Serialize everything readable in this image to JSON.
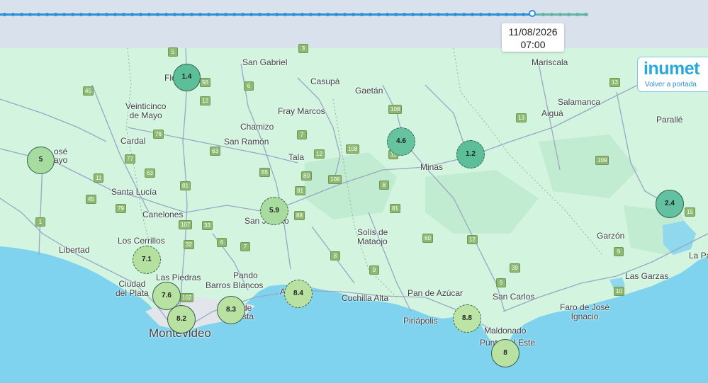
{
  "timeline": {
    "selected_date": "11/08/2026",
    "selected_time": "07:00"
  },
  "logo": {
    "brand": "inumet",
    "back_label": "Volver a portada"
  },
  "places": {
    "mariscala": "Mariscala",
    "san_gabriel": "San Gabriel",
    "casupa": "Casupá",
    "gaetan": "Gaetán",
    "salamanca": "Salamanca",
    "veinticinco_de_mayo": "Veinticinco\nde Mayo",
    "fray_marcos": "Fray Marcos",
    "aigua": "Aiguá",
    "parallel": "Parallé",
    "chamizo": "Chamizo",
    "cardal": "Cardal",
    "san_ramon": "San Ramón",
    "jose_fragment": "osé\nayo",
    "tala": "Tala",
    "minas": "Minas",
    "santa_lucia": "Santa Lucía",
    "canelones": "Canelones",
    "san_jacinto": "San Jacinto",
    "solis_de_mataojo": "Solís de\nMataojo",
    "garzon": "Garzón",
    "los_cerrillos": "Los Cerrillos",
    "libertad": "Libertad",
    "la_pa": "La Pa",
    "pando": "Pando",
    "las_piedras": "Las Piedras",
    "barros_blancos": "Barros Blancos",
    "ciudad_del_plata": "Ciudad\ndel Plata",
    "las_garzas": "Las Garzas",
    "pan_de_azucar": "Pan de Azúcar",
    "cuchilla_alta": "Cuchilla Alta",
    "san_carlos": "San Carlos",
    "faro_de_jose_ignacio": "Faro de José\nIgnacio",
    "piriapolis": "Piriápolis",
    "montevideo": "Montevideo",
    "maldonado": "Maldonado",
    "punta_del_este": "Punta del Este",
    "atlantida_fragment": "At",
    "ciudad_de_la_costa_fragment": "de\nsta",
    "flo_fragment": "Flo"
  },
  "routes": [
    "5",
    "56",
    "12",
    "45",
    "6",
    "76",
    "13",
    "77",
    "63",
    "108",
    "7",
    "12",
    "108",
    "109",
    "11",
    "45",
    "79",
    "81",
    "65",
    "80",
    "108",
    "11",
    "63",
    "8",
    "81",
    "13",
    "15",
    "1",
    "107",
    "33",
    "88",
    "81",
    "60",
    "12",
    "32",
    "6",
    "7",
    "8",
    "9",
    "39",
    "9",
    "10",
    "9",
    "102",
    "3"
  ],
  "stations": [
    {
      "value": "1.4",
      "color": "#5cbf9a"
    },
    {
      "value": "5",
      "color": "#a7dca0"
    },
    {
      "value": "4.6",
      "color": "#66c3a0"
    },
    {
      "value": "1.2",
      "color": "#5cbf9a"
    },
    {
      "value": "2.4",
      "color": "#62c1a0"
    },
    {
      "value": "5.9",
      "color": "#a8dc9e"
    },
    {
      "value": "7.1",
      "color": "#b4e0a0"
    },
    {
      "value": "7.6",
      "color": "#b7e2a2"
    },
    {
      "value": "8.2",
      "color": "#b9e2a2"
    },
    {
      "value": "8.3",
      "color": "#b9e2a2"
    },
    {
      "value": "8.4",
      "color": "#b9e2a2"
    },
    {
      "value": "8.8",
      "color": "#bce4a4"
    },
    {
      "value": "8",
      "color": "#b9e2a2"
    }
  ],
  "colors": {
    "land": "#d3f5e0",
    "water": "#7fd3ee",
    "roads": "#9aa6c4",
    "timeline_past": "#2d8fd8",
    "timeline_future": "#5fb3a8",
    "brand": "#29a8dc"
  }
}
